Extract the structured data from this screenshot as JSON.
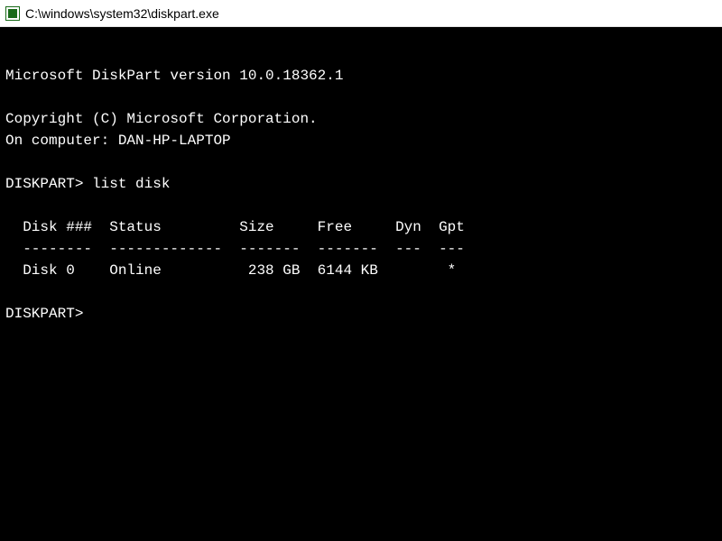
{
  "titlebar": {
    "path": "C:\\windows\\system32\\diskpart.exe"
  },
  "terminal": {
    "version_line": "Microsoft DiskPart version 10.0.18362.1",
    "copyright_line": "Copyright (C) Microsoft Corporation.",
    "computer_line": "On computer: DAN-HP-LAPTOP",
    "prompt1_label": "DISKPART> ",
    "prompt1_command": "list disk",
    "table": {
      "indent": "  ",
      "header": "Disk ###  Status         Size     Free     Dyn  Gpt",
      "divider": "--------  -------------  -------  -------  ---  ---",
      "rows": [
        "Disk 0    Online          238 GB  6144 KB        *"
      ]
    },
    "prompt2_label": "DISKPART> ",
    "prompt2_command": ""
  }
}
